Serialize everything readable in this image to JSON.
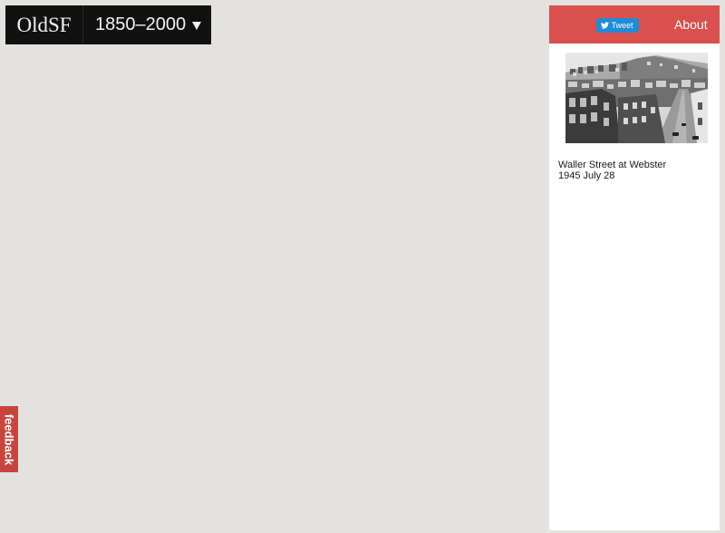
{
  "header": {
    "brand": "OldSF",
    "year_range": "1850–2000"
  },
  "feedback": {
    "label": "feedback"
  },
  "panel": {
    "tweet_label": "Tweet",
    "about_label": "About",
    "photo": {
      "title": "Waller Street at Webster",
      "date": "1945 July 28"
    }
  },
  "colors": {
    "panel_header": "#d9504c",
    "feedback_tab": "#c8453f",
    "tweet_button": "#1d8cd6",
    "brand_bar": "#111111",
    "map_background": "#e4e2de"
  },
  "icons": {
    "tweet": "twitter-bird-icon",
    "year_dropdown": "caret-down-icon"
  }
}
